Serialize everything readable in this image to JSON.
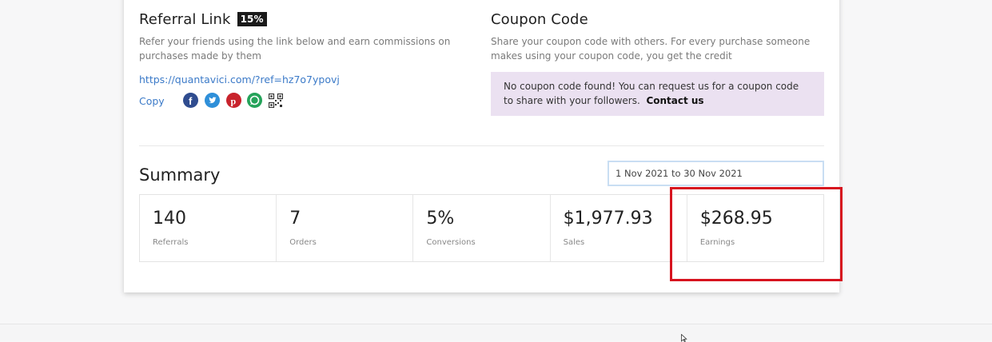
{
  "referral": {
    "title": "Referral Link",
    "badge": "15%",
    "description_line1": "Refer your friends using the link below and earn commissions on",
    "description_line2": "purchases made by them",
    "url": "https://quantavici.com/?ref=hz7o7ypovj",
    "copy_label": "Copy",
    "share_icons": [
      "facebook-icon",
      "twitter-icon",
      "pinterest-icon",
      "whatsapp-icon",
      "qr-code-icon"
    ]
  },
  "coupon": {
    "title": "Coupon Code",
    "description_line1": "Share your coupon code with others. For every purchase someone",
    "description_line2": "makes using your coupon code, you get the credit",
    "notice_line1": "No coupon code found! You can request us for a coupon code",
    "notice_line2": "to share with your followers.",
    "contact_label": "Contact us",
    "notice_color": "#ebe1f1"
  },
  "summary": {
    "title": "Summary",
    "date_range": "1 Nov 2021 to 30 Nov 2021",
    "stats": [
      {
        "value": "140",
        "label": "Referrals"
      },
      {
        "value": "7",
        "label": "Orders"
      },
      {
        "value": "5%",
        "label": "Conversions"
      },
      {
        "value": "$1,977.93",
        "label": "Sales"
      },
      {
        "value": "$268.95",
        "label": "Earnings"
      }
    ]
  },
  "colors": {
    "link": "#3b7ac8",
    "highlight_border": "#d7141f",
    "badge_bg": "#1a1a1a"
  }
}
